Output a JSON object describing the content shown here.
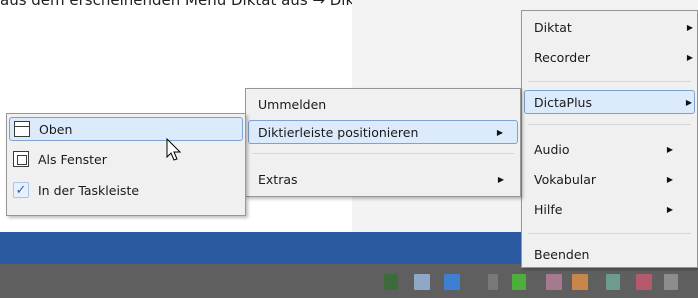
{
  "top_text": "aus dem erscheinenden Menü Diktat aus → Diktierleiste positionieren",
  "main_menu": {
    "items": [
      {
        "label": "Diktat",
        "submenu": true
      },
      {
        "label": "Recorder",
        "submenu": true
      },
      {
        "label": "DictaPlus",
        "submenu": true,
        "highlighted": true
      },
      {
        "label": "Audio",
        "submenu": true
      },
      {
        "label": "Vokabular",
        "submenu": true
      },
      {
        "label": "Hilfe",
        "submenu": true
      },
      {
        "label": "Beenden",
        "submenu": false
      }
    ]
  },
  "dictaplus_menu": {
    "items": [
      {
        "label": "Ummelden",
        "submenu": false
      },
      {
        "label": "Diktierleiste positionieren",
        "submenu": true,
        "highlighted": true
      },
      {
        "label": "Extras",
        "submenu": true
      }
    ]
  },
  "position_menu": {
    "items": [
      {
        "label": "Oben",
        "icon": "top-bar-icon",
        "highlighted": true
      },
      {
        "label": "Als Fenster",
        "icon": "window-icon"
      },
      {
        "label": "In der Taskleiste",
        "icon": "checkmark-icon",
        "checked": true
      }
    ]
  },
  "colors": {
    "menu_bg": "#f0f0f0",
    "highlight_bg": "#dcebfc",
    "highlight_border": "#7da2ce",
    "taskbar_blue": "#2c5aa0",
    "taskbar_gray": "#5f5f5f"
  }
}
